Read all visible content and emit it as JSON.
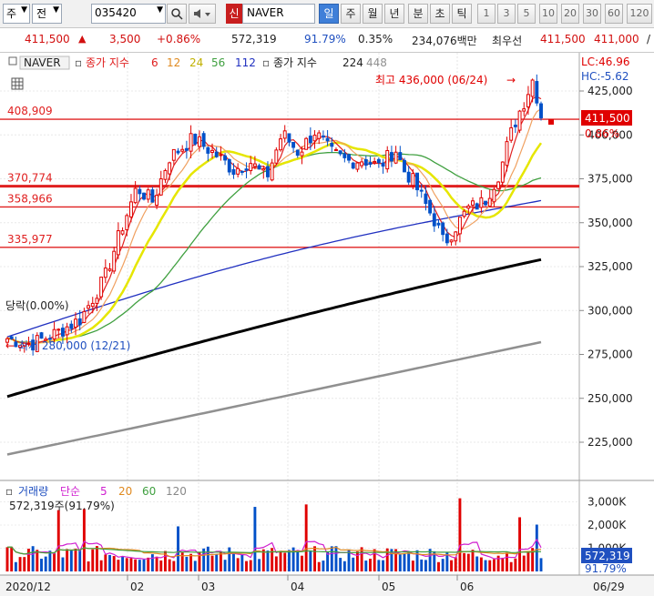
{
  "toolbar": {
    "market": "주",
    "kind": "전",
    "code": "035420",
    "sin": "신",
    "name": "NAVER",
    "periods": [
      "일",
      "주",
      "월",
      "년",
      "분",
      "초",
      "틱"
    ],
    "nums": [
      "1",
      "3",
      "5",
      "10",
      "20",
      "30",
      "60",
      "120"
    ]
  },
  "quote": {
    "price": "411,500",
    "change": "3,500",
    "pct": "+0.86%",
    "volume": "572,319",
    "ratio": "91.79%",
    "turnover": "0.35%",
    "amount": "234,076백만",
    "priority": "최우선",
    "bid": "411,500",
    "ask": "411,000",
    "more": "/"
  },
  "legend": {
    "name": "NAVER",
    "ma_label": "종가 지수",
    "ma": [
      "6",
      "12",
      "24",
      "56",
      "112"
    ],
    "ma2_label": "종가 지수",
    "ma2": [
      "224",
      "448"
    ]
  },
  "colors": {
    "ma6": "#e02020",
    "ma12": "#f0a060",
    "ma24": "#e6e600",
    "ma56": "#40a040",
    "ma112": "#2030c0",
    "ma224": "#000000",
    "ma448": "#909090",
    "up": "#e00000",
    "down": "#0050c8"
  },
  "annotations": {
    "high": "최고 436,000 (06/24)",
    "low": "최저 280,000 (12/21)",
    "fall": "당락(0.00%)",
    "lc": "LC:46.96",
    "hc": "HC:-5.62"
  },
  "levels": [
    {
      "label": "408,909",
      "value": 408909
    },
    {
      "label": "370,774",
      "value": 370774
    },
    {
      "label": "358,966",
      "value": 358966
    },
    {
      "label": "335,977",
      "value": 335977
    }
  ],
  "price_axis": [
    "425,000",
    "400,000",
    "375,000",
    "350,000",
    "325,000",
    "300,000",
    "275,000",
    "250,000",
    "225,000"
  ],
  "current": {
    "price": "411,500",
    "pct": "0.86%"
  },
  "volume_legend": {
    "title": "거래량",
    "mode": "단순",
    "ma": [
      "5",
      "20",
      "60",
      "120"
    ],
    "value": "572,319주(91.79%)"
  },
  "volume_axis": [
    "3,000K",
    "2,000K",
    "1,000K"
  ],
  "volume_current": {
    "value": "572,319",
    "pct": "91.79%"
  },
  "x_axis": [
    "2020/12",
    "02",
    "03",
    "04",
    "05",
    "06"
  ],
  "date_label": "06/29"
}
